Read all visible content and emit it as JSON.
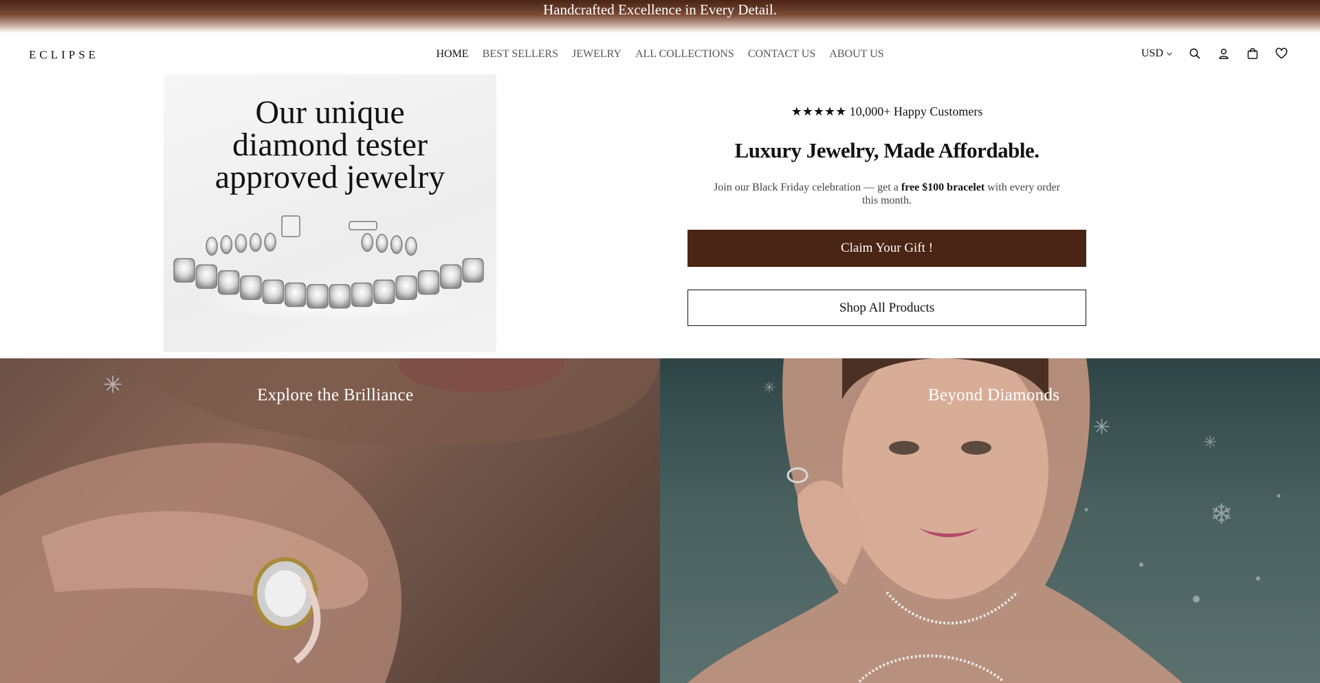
{
  "announcement": {
    "text": "Handcrafted Excellence in Every Detail."
  },
  "header": {
    "logo": "ECLIPSE",
    "nav": [
      {
        "label": "HOME",
        "active": true
      },
      {
        "label": "BEST SELLERS",
        "active": false
      },
      {
        "label": "JEWELRY",
        "active": false
      },
      {
        "label": "ALL COLLECTIONS",
        "active": false
      },
      {
        "label": "CONTACT US",
        "active": false
      },
      {
        "label": "ABOUT US",
        "active": false
      }
    ],
    "currency": "USD",
    "icons": [
      "search-icon",
      "account-icon",
      "cart-icon",
      "wishlist-icon"
    ]
  },
  "promo": {
    "headline_lines": [
      "Our unique",
      "diamond tester",
      "approved jewelry"
    ]
  },
  "hero": {
    "rating": "★★★★★ 10,000+ Happy Customers",
    "headline": "Luxury Jewelry, Made Affordable.",
    "subtext_before": "Join our Black Friday celebration — get a ",
    "subtext_bold": "free $100 bracelet",
    "subtext_after": " with every order this month.",
    "primary_button": "Claim Your Gift !",
    "secondary_button": "Shop All Products"
  },
  "tiles": [
    {
      "title": "Explore the Brilliance"
    },
    {
      "title": "Beyond Diamonds"
    }
  ],
  "colors": {
    "brand_brown": "#4a2414",
    "announcement_bg": "#4a2415",
    "text_dark": "#111111"
  }
}
